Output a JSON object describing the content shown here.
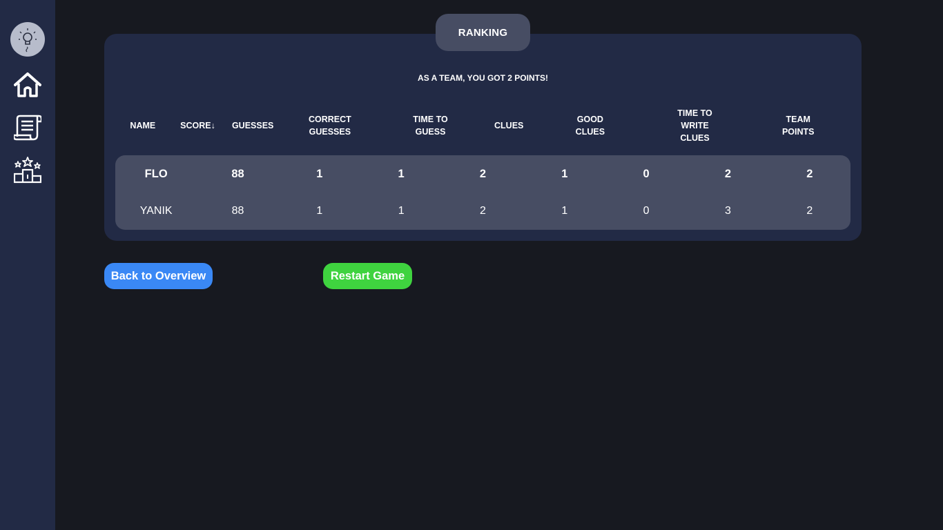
{
  "sidebar": {
    "logo_icon": "lightbulb-logo-icon",
    "items": [
      {
        "icon": "home-icon"
      },
      {
        "icon": "scroll-icon"
      },
      {
        "icon": "podium-icon"
      }
    ]
  },
  "ranking": {
    "tab_label": "RANKING",
    "team_message": "AS A TEAM, YOU GOT 2 POINTS!",
    "columns": [
      "NAME",
      "SCORE↓",
      "GUESSES",
      "CORRECT GUESSES",
      "TIME TO GUESS",
      "CLUES",
      "GOOD CLUES",
      "TIME TO WRITE CLUES",
      "TEAM POINTS"
    ],
    "rows": [
      [
        "FLO",
        "88",
        "1",
        "1",
        "2",
        "1",
        "0",
        "2",
        "2"
      ],
      [
        "YANIK",
        "88",
        "1",
        "1",
        "2",
        "1",
        "0",
        "3",
        "2"
      ]
    ]
  },
  "buttons": {
    "back_label": "Back to Overview",
    "restart_label": "Restart Game"
  },
  "colors": {
    "background": "#171920",
    "sidebar": "#222a45",
    "card": "#222a45",
    "rows": "#474d63",
    "back_button": "#3a88f5",
    "restart_button": "#3fd33f"
  }
}
